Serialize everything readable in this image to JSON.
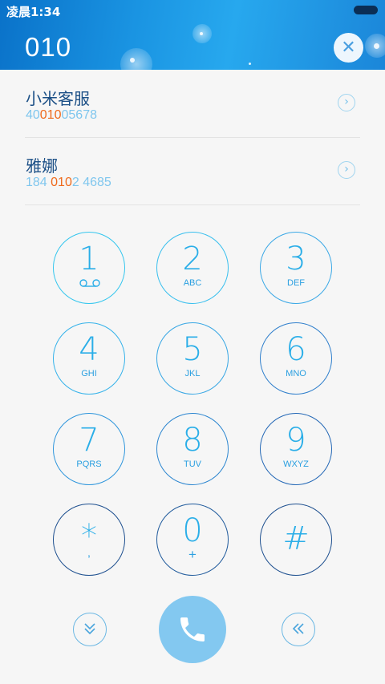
{
  "status_bar": {
    "time": "凌晨1:34"
  },
  "dialer": {
    "number": "010"
  },
  "contacts": [
    {
      "name": "小米客服",
      "number_parts": [
        "40",
        "010",
        "05678"
      ]
    },
    {
      "name": "雅娜",
      "number_parts": [
        "184 ",
        "010",
        "2 4685"
      ]
    }
  ],
  "keypad": [
    {
      "digit": "1",
      "letters": "",
      "icon": "voicemail-icon"
    },
    {
      "digit": "2",
      "letters": "ABC"
    },
    {
      "digit": "3",
      "letters": "DEF"
    },
    {
      "digit": "4",
      "letters": "GHI"
    },
    {
      "digit": "5",
      "letters": "JKL"
    },
    {
      "digit": "6",
      "letters": "MNO"
    },
    {
      "digit": "7",
      "letters": "PQRS"
    },
    {
      "digit": "8",
      "letters": "TUV"
    },
    {
      "digit": "9",
      "letters": "WXYZ"
    },
    {
      "digit": "*",
      "letters": ","
    },
    {
      "digit": "0",
      "letters": "+"
    },
    {
      "digit": "#",
      "letters": ""
    }
  ],
  "bottom_bar": {
    "collapse_icon": "chevron-double-down-icon",
    "call_icon": "phone-icon",
    "backspace_icon": "chevron-double-left-icon"
  },
  "colors": {
    "accent": "#2aaee8",
    "highlight": "#ef6a1c",
    "call": "#83c8f0",
    "header": "#1a94e2"
  }
}
